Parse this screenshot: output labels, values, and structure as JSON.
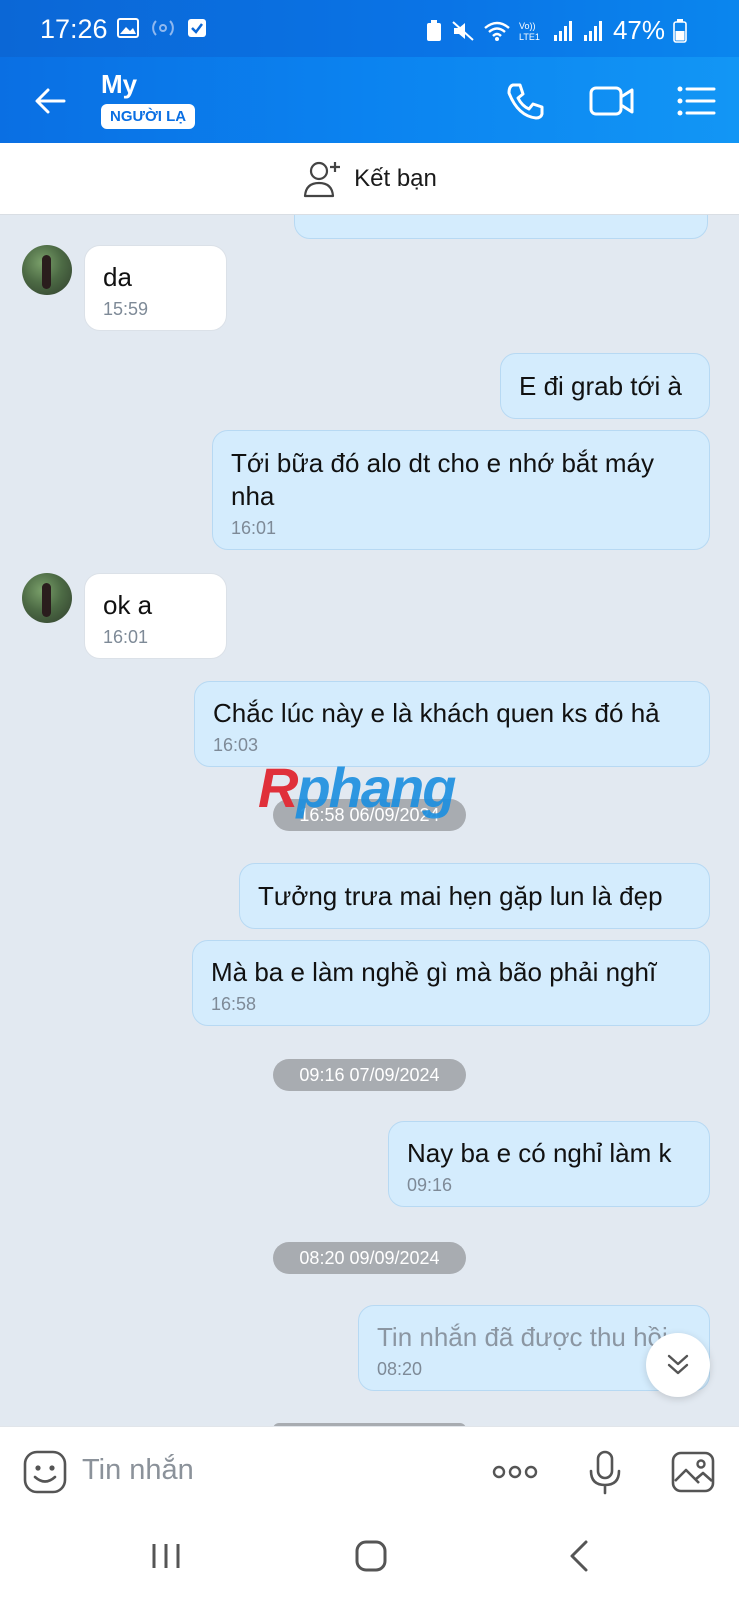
{
  "status": {
    "time": "17:26",
    "battery": "47%"
  },
  "header": {
    "name": "My",
    "badge": "NGƯỜI LẠ"
  },
  "add_friend": {
    "label": "Kết bạn"
  },
  "messages": [
    {
      "dir": "in",
      "text": "da",
      "time": "15:59"
    },
    {
      "dir": "out",
      "text": "E đi grab tới à"
    },
    {
      "dir": "out",
      "text": "Tới bữa đó alo dt cho e nhớ bắt máy nha",
      "time": "16:01"
    },
    {
      "dir": "in",
      "text": "ok a",
      "time": "16:01"
    },
    {
      "dir": "out",
      "text": "Chắc lúc này e là khách quen ks đó hả",
      "time": "16:03"
    },
    {
      "dir": "out",
      "text": "Tưởng trưa mai hẹn gặp lun là đẹp"
    },
    {
      "dir": "out",
      "text": "Mà ba e làm nghề gì mà bão phải nghĩ",
      "time": "16:58"
    },
    {
      "dir": "out",
      "text": "Nay ba e có nghỉ làm k",
      "time": "09:16"
    },
    {
      "dir": "out",
      "text": "Tin nhắn đã được thu hồi",
      "time": "08:20"
    }
  ],
  "date_separators": [
    "16:58 06/09/2024",
    "09:16 07/09/2024",
    "08:20 09/09/2024"
  ],
  "watermark": {
    "first": "R",
    "rest": "phang"
  },
  "composer": {
    "placeholder": "Tin nhắn"
  },
  "colors": {
    "header_blue": "#0a7ae8",
    "outgoing_bubble": "#d4ecfd",
    "chat_bg": "#e2e9f1"
  }
}
